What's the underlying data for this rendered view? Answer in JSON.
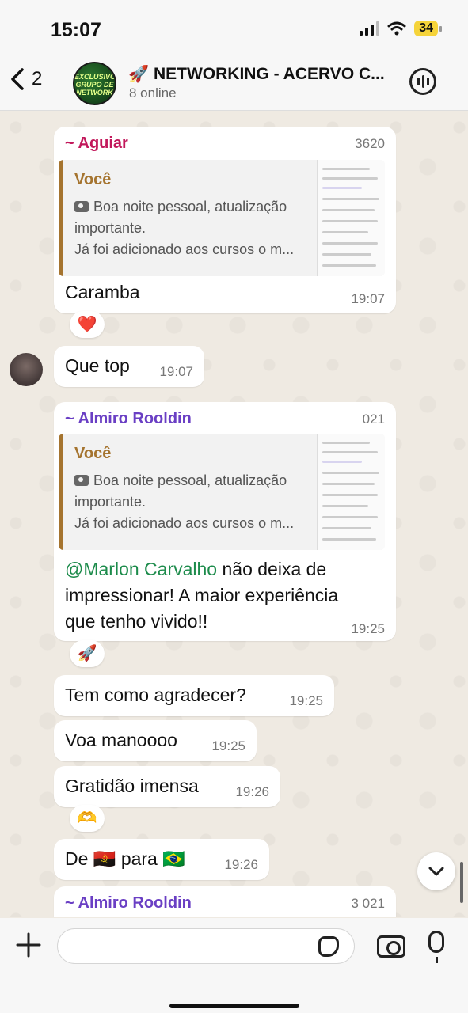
{
  "status": {
    "time": "15:07",
    "battery": "34"
  },
  "header": {
    "back_count": "2",
    "avatar_text": "EXCLUSIVO GRUPO DE NETWORK",
    "title": "🚀 NETWORKING - ACERVO C...",
    "subtitle": "8 online"
  },
  "messages": {
    "m1": {
      "sender": "~ Aguiar",
      "phone": "3620",
      "quote_name": "Você",
      "quote_line1": "Boa noite pessoal, atualização",
      "quote_line2": "importante.",
      "quote_line3": "Já foi adicionado aos cursos o m...",
      "text": "Caramba",
      "time": "19:07",
      "reaction": "❤️"
    },
    "m2": {
      "text": "Que top",
      "time": "19:07"
    },
    "m3": {
      "sender": "~ Almiro Rooldin",
      "phone": "021",
      "quote_name": "Você",
      "quote_line1": "Boa noite pessoal, atualização",
      "quote_line2": "importante.",
      "quote_line3": "Já foi adicionado aos cursos o m...",
      "mention": "@Marlon Carvalho",
      "text_part1": " não deixa de",
      "text_part2": "impressionar! A maior experiência",
      "text_part3": "que tenho vivido!!",
      "time": "19:25",
      "reaction": "🚀"
    },
    "m4": {
      "text": "Tem como agradecer?",
      "time": "19:25"
    },
    "m5": {
      "text": "Voa manoooo",
      "time": "19:25"
    },
    "m6": {
      "text": "Gratidão imensa",
      "time": "19:26",
      "reaction": "🫶"
    },
    "m7": {
      "text": "De 🇦🇴 para 🇧🇷",
      "time": "19:26"
    },
    "m8": {
      "sender": "~ Almiro Rooldin",
      "phone": "3 021"
    }
  },
  "input": {
    "placeholder": ""
  },
  "colors": {
    "aguiar": "#c2185b",
    "almiro": "#6a3fc4",
    "mention": "#1c8b4b",
    "quote_accent": "#a5742f"
  }
}
